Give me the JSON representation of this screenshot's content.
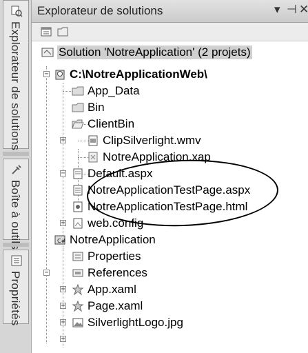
{
  "sidebar": {
    "tabs": [
      {
        "label": "Explorateur de solutions",
        "icon": "solution-explorer-icon"
      },
      {
        "label": "Boîte à outils",
        "icon": "toolbox-icon"
      },
      {
        "label": "Propriétés",
        "icon": "properties-icon"
      }
    ]
  },
  "panel": {
    "title": "Explorateur de solutions",
    "dropdown_glyph": "▾",
    "pin_glyph": "⊣",
    "close_glyph": "✕"
  },
  "toolbar": {
    "buttons": [
      {
        "icon": "properties-icon"
      },
      {
        "icon": "show-all-files-icon"
      }
    ]
  },
  "tree": {
    "solution": "Solution 'NotreApplication' (2 projets)",
    "web_project": "C:\\NotreApplicationWeb\\",
    "app_data": "App_Data",
    "bin": "Bin",
    "clientbin": "ClientBin",
    "clip": "ClipSilverlight.wmv",
    "xap": "NotreApplication.xap",
    "default_aspx": "Default.aspx",
    "testpage_aspx": "NotreApplicationTestPage.aspx",
    "testpage_html": "NotreApplicationTestPage.html",
    "web_config": "web.config",
    "sl_project": "NotreApplication",
    "properties": "Properties",
    "references": "References",
    "app_xaml": "App.xaml",
    "page_xaml": "Page.xaml",
    "logo": "SilverlightLogo.jpg"
  },
  "expanders": {
    "collapsed": "+",
    "expanded": "−"
  }
}
